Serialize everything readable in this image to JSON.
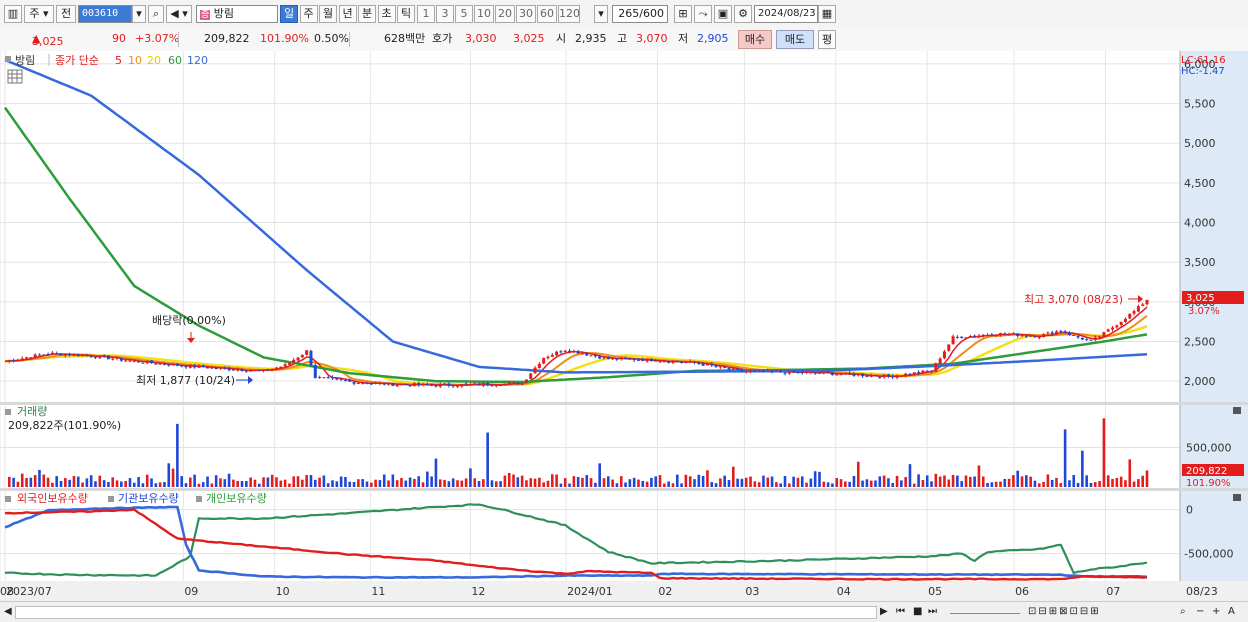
{
  "toolbar": {
    "market": "주",
    "market2": "전",
    "code": "003610",
    "name": "방림",
    "periods": [
      "일",
      "주",
      "월",
      "년",
      "분",
      "초",
      "틱"
    ],
    "active_period": "일",
    "intervals": [
      "1",
      "3",
      "5",
      "10",
      "20",
      "30",
      "60",
      "120"
    ],
    "count": "265",
    "count_total": "/600",
    "date": "2024/08/23"
  },
  "quote": {
    "price": "3,025",
    "change": "90",
    "change_pct": "+3.07%",
    "volume": "209,822",
    "volume_ratio": "101.90%",
    "turnover": "0.50%",
    "amount": "628백만",
    "ask_label": "호가",
    "ask": "3,030",
    "bid": "3,025",
    "open_label": "시",
    "open": "2,935",
    "high_label": "고",
    "high": "3,070",
    "low_label": "저",
    "low": "2,905",
    "buy_button": "매수",
    "sell_button": "매도",
    "eval_button": "평"
  },
  "colors": {
    "up": "#e21d1d",
    "down": "#1f47d6",
    "ma5": "#e21d1d",
    "ma10": "#f08c1e",
    "ma20": "#f2e01b",
    "ma60": "#2e9c3a",
    "ma120": "#3569dc",
    "panel_bg": "#dde9f7"
  },
  "chart_data": [
    {
      "type": "candlestick",
      "legend_name": "방림",
      "legend_ma_label": "종가 단순",
      "ma_periods": [
        "5",
        "10",
        "20",
        "60",
        "120"
      ],
      "lc_label": "LC:61.16",
      "hc_label": "HC:-1.47",
      "yticks": [
        "6,000",
        "5,500",
        "5,000",
        "4,500",
        "4,000",
        "3,500",
        "3,000",
        "2,500",
        "2,000"
      ],
      "ylim": [
        1750,
        6100
      ],
      "xticks": [
        "2023/07",
        "09",
        "10",
        "11",
        "12",
        "2024/01",
        "02",
        "03",
        "04",
        "05",
        "06",
        "07",
        "08",
        "08/23"
      ],
      "last_price_tag": "3,025",
      "last_pct_tag": "3.07%",
      "annotations": {
        "dividend": "배당락(0.00%)",
        "low": "최저 1,877 (10/24)",
        "high": "최고 3,070 (08/23)"
      },
      "close_path": [
        [
          0,
          2250
        ],
        [
          10,
          2350
        ],
        [
          20,
          2320
        ],
        [
          30,
          2250
        ],
        [
          40,
          2200
        ],
        [
          50,
          2160
        ],
        [
          60,
          2130
        ],
        [
          65,
          2200
        ],
        [
          70,
          2380
        ],
        [
          72,
          2050
        ],
        [
          80,
          1990
        ],
        [
          90,
          1960
        ],
        [
          100,
          1950
        ],
        [
          110,
          1960
        ],
        [
          120,
          1975
        ],
        [
          125,
          2300
        ],
        [
          130,
          2400
        ],
        [
          140,
          2280
        ],
        [
          150,
          2270
        ],
        [
          160,
          2230
        ],
        [
          170,
          2130
        ],
        [
          175,
          2120
        ],
        [
          190,
          2100
        ],
        [
          205,
          2060
        ],
        [
          215,
          2130
        ],
        [
          220,
          2550
        ],
        [
          230,
          2600
        ],
        [
          240,
          2570
        ],
        [
          245,
          2640
        ],
        [
          248,
          2570
        ],
        [
          252,
          2500
        ],
        [
          255,
          2600
        ],
        [
          258,
          2720
        ],
        [
          262,
          2880
        ],
        [
          265,
          3025
        ]
      ],
      "ma60_path": [
        [
          0,
          5450
        ],
        [
          15,
          4300
        ],
        [
          30,
          3200
        ],
        [
          45,
          2700
        ],
        [
          60,
          2300
        ],
        [
          80,
          2100
        ],
        [
          100,
          2000
        ],
        [
          120,
          1990
        ],
        [
          140,
          2050
        ],
        [
          160,
          2130
        ],
        [
          180,
          2140
        ],
        [
          200,
          2160
        ],
        [
          220,
          2220
        ],
        [
          240,
          2380
        ],
        [
          255,
          2500
        ],
        [
          265,
          2590
        ]
      ],
      "ma120_path": [
        [
          0,
          6050
        ],
        [
          20,
          5600
        ],
        [
          45,
          4600
        ],
        [
          70,
          3400
        ],
        [
          90,
          2500
        ],
        [
          110,
          2180
        ],
        [
          130,
          2110
        ],
        [
          160,
          2120
        ],
        [
          190,
          2130
        ],
        [
          215,
          2190
        ],
        [
          240,
          2260
        ],
        [
          265,
          2340
        ]
      ]
    },
    {
      "type": "bar",
      "title": "거래량",
      "volume_label": "209,822주(101.90%)",
      "yticks": [
        "500,000"
      ],
      "ylim": [
        0,
        900000
      ],
      "last_value_tag": "209,822",
      "last_pct_tag": "101.90%",
      "spikes": [
        [
          40,
          800000
        ],
        [
          100,
          360000
        ],
        [
          112,
          690000
        ],
        [
          138,
          300000
        ],
        [
          198,
          320000
        ],
        [
          210,
          290000
        ],
        [
          246,
          730000
        ],
        [
          250,
          460000
        ],
        [
          255,
          870000
        ],
        [
          261,
          350000
        ]
      ]
    },
    {
      "type": "line",
      "series": [
        {
          "name": "외국인보유수량"
        },
        {
          "name": "기관보유수량"
        },
        {
          "name": "개인보유수량"
        }
      ],
      "yticks": [
        "0",
        "-500,000"
      ],
      "ylim": [
        -800000,
        200000
      ],
      "foreign_path": [
        [
          0,
          -40000
        ],
        [
          20,
          -20000
        ],
        [
          30,
          0
        ],
        [
          33,
          -100000
        ],
        [
          40,
          -330000
        ],
        [
          60,
          -420000
        ],
        [
          80,
          -510000
        ],
        [
          100,
          -580000
        ],
        [
          110,
          -640000
        ],
        [
          120,
          -690000
        ],
        [
          130,
          -730000
        ],
        [
          135,
          -700000
        ],
        [
          150,
          -720000
        ],
        [
          152,
          -780000
        ],
        [
          200,
          -790000
        ],
        [
          245,
          -790000
        ],
        [
          250,
          -760000
        ],
        [
          265,
          -770000
        ]
      ],
      "institution_path": [
        [
          0,
          -200000
        ],
        [
          10,
          -10000
        ],
        [
          20,
          10000
        ],
        [
          40,
          30000
        ],
        [
          42,
          -400000
        ],
        [
          45,
          -690000
        ],
        [
          60,
          -760000
        ],
        [
          80,
          -770000
        ],
        [
          110,
          -770000
        ],
        [
          130,
          -750000
        ],
        [
          150,
          -750000
        ],
        [
          152,
          -730000
        ],
        [
          245,
          -740000
        ],
        [
          250,
          -760000
        ],
        [
          265,
          -760000
        ]
      ],
      "individual_path": [
        [
          0,
          -720000
        ],
        [
          15,
          -740000
        ],
        [
          35,
          -750000
        ],
        [
          43,
          -530000
        ],
        [
          45,
          -100000
        ],
        [
          60,
          -100000
        ],
        [
          80,
          -40000
        ],
        [
          100,
          30000
        ],
        [
          110,
          60000
        ],
        [
          118,
          -30000
        ],
        [
          130,
          -180000
        ],
        [
          140,
          -480000
        ],
        [
          150,
          -610000
        ],
        [
          180,
          -580000
        ],
        [
          215,
          -530000
        ],
        [
          222,
          -500000
        ],
        [
          225,
          -580000
        ],
        [
          228,
          -480000
        ],
        [
          240,
          -450000
        ],
        [
          245,
          -400000
        ],
        [
          248,
          -720000
        ],
        [
          252,
          -680000
        ],
        [
          258,
          -650000
        ],
        [
          265,
          -600000
        ]
      ]
    }
  ]
}
